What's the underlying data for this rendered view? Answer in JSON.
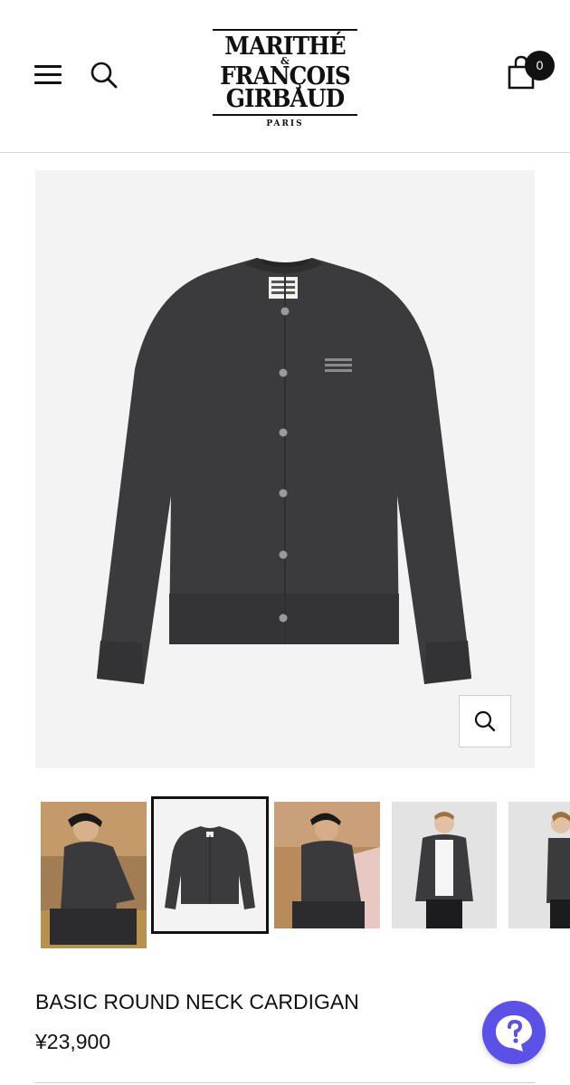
{
  "header": {
    "logo": {
      "line1": "MARITHÉ",
      "amp": "&",
      "line2": "FRANÇOIS",
      "line3": "GIRBAUD",
      "city": "PARIS"
    },
    "cart_count": "0"
  },
  "product": {
    "title": "BASIC ROUND NECK CARDIGAN",
    "price": "¥23,900",
    "thumbnails": [
      {
        "name": "model-seated-straw",
        "selected": false
      },
      {
        "name": "product-flat",
        "selected": true
      },
      {
        "name": "model-seated-blanket",
        "selected": false
      },
      {
        "name": "model-front-studio",
        "selected": false
      },
      {
        "name": "model-side-studio",
        "selected": false
      }
    ]
  },
  "colors": {
    "cardigan": "#3b3b3d",
    "image_bg": "#f3f3f3",
    "help_button": "#5b50e8"
  }
}
